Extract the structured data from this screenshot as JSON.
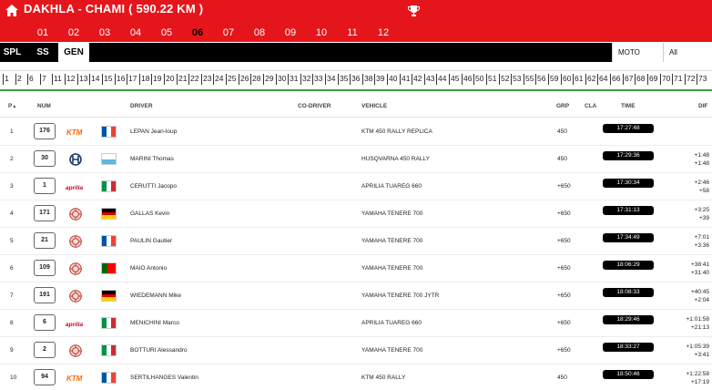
{
  "header": {
    "title": "DAKHLA - CHAMI ( 590.22 KM )",
    "home_icon": "home-icon",
    "trophy_icon": "trophy-icon"
  },
  "stages": [
    "01",
    "02",
    "03",
    "04",
    "05",
    "06",
    "07",
    "08",
    "09",
    "10",
    "11",
    "12"
  ],
  "active_stage": "06",
  "filters": {
    "tabs": [
      "SPL",
      "SS",
      "GEN"
    ],
    "active_tab": "GEN",
    "category": "MOTO",
    "class_filter": "All"
  },
  "waypoints": [
    "1",
    "2",
    "6",
    "7",
    "11",
    "12",
    "13",
    "14",
    "15",
    "16",
    "17",
    "18",
    "19",
    "20",
    "21",
    "22",
    "23",
    "24",
    "25",
    "26",
    "28",
    "29",
    "30",
    "31",
    "32",
    "33",
    "34",
    "35",
    "36",
    "38",
    "39",
    "40",
    "41",
    "42",
    "43",
    "44",
    "45",
    "46",
    "50",
    "51",
    "52",
    "53",
    "55",
    "56",
    "59",
    "60",
    "61",
    "62",
    "64",
    "66",
    "67",
    "68",
    "69",
    "70",
    "71",
    "72",
    "73"
  ],
  "table": {
    "headers": {
      "pos": "P",
      "num": "NUM",
      "driver": "DRIVER",
      "codriver": "CO-DRIVER",
      "vehicle": "VEHICLE",
      "grp": "GRP",
      "cla": "CLA",
      "time": "TIME",
      "dif": "DIF"
    },
    "rows": [
      {
        "pos": "1",
        "num": "176",
        "brand": "ktm",
        "flag": "fr",
        "driver": "LEPAN Jean-loup",
        "vehicle": "KTM 450 RALLY REPLICA",
        "grp": "450",
        "time": "17:27:48",
        "dif1": "",
        "dif2": ""
      },
      {
        "pos": "2",
        "num": "30",
        "brand": "husqvarna",
        "flag": "sm",
        "driver": "MARINI Thomas",
        "vehicle": "HUSQVARNA 450 RALLY",
        "grp": "450",
        "time": "17:29:36",
        "dif1": "+1:48",
        "dif2": "+1:48"
      },
      {
        "pos": "3",
        "num": "1",
        "brand": "aprilia",
        "flag": "it",
        "driver": "CERUTTI Jacopo",
        "vehicle": "APRILIA TUAREG 660",
        "grp": "+650",
        "time": "17:30:34",
        "dif1": "+2:46",
        "dif2": "+58"
      },
      {
        "pos": "4",
        "num": "171",
        "brand": "yamaha",
        "flag": "de",
        "driver": "GALLAS Kevin",
        "vehicle": "YAMAHA TENERE 700",
        "grp": "+650",
        "time": "17:31:13",
        "dif1": "+3:25",
        "dif2": "+39"
      },
      {
        "pos": "5",
        "num": "21",
        "brand": "yamaha",
        "flag": "fr",
        "driver": "PAULIN Gautier",
        "vehicle": "YAMAHA TENERE 700",
        "grp": "+650",
        "time": "17:34:49",
        "dif1": "+7:01",
        "dif2": "+3:36"
      },
      {
        "pos": "6",
        "num": "109",
        "brand": "yamaha",
        "flag": "pt",
        "driver": "MAIO Antonio",
        "vehicle": "YAMAHA TENERE 700",
        "grp": "+650",
        "time": "18:06:29",
        "dif1": "+38:41",
        "dif2": "+31:40"
      },
      {
        "pos": "7",
        "num": "191",
        "brand": "yamaha",
        "flag": "de",
        "driver": "WIEDEMANN Mike",
        "vehicle": "YAMAHA TENERE 700 JYTR",
        "grp": "+650",
        "time": "18:08:33",
        "dif1": "+40:45",
        "dif2": "+2:04"
      },
      {
        "pos": "8",
        "num": "6",
        "brand": "aprilia",
        "flag": "it",
        "driver": "MENICHINI Marco",
        "vehicle": "APRILIA TUAREG 660",
        "grp": "+650",
        "time": "18:29:46",
        "dif1": "+1:01:58",
        "dif2": "+21:13"
      },
      {
        "pos": "9",
        "num": "2",
        "brand": "yamaha",
        "flag": "it",
        "driver": "BOTTURI Alessandro",
        "vehicle": "YAMAHA TENERE 700",
        "grp": "+650",
        "time": "18:33:27",
        "dif1": "+1:05:39",
        "dif2": "+3:41"
      },
      {
        "pos": "10",
        "num": "94",
        "brand": "ktm",
        "flag": "fr",
        "driver": "SERTILHANGES Valentin",
        "vehicle": "KTM 450 RALLY",
        "grp": "450",
        "time": "18:50:46",
        "dif1": "+1:22:58",
        "dif2": "+17:19"
      }
    ]
  },
  "colors": {
    "brand_red": "#e5161b",
    "progress_green": "#3aa040",
    "ktm_orange": "#ff6600",
    "aprilia_red": "#d0021b"
  }
}
